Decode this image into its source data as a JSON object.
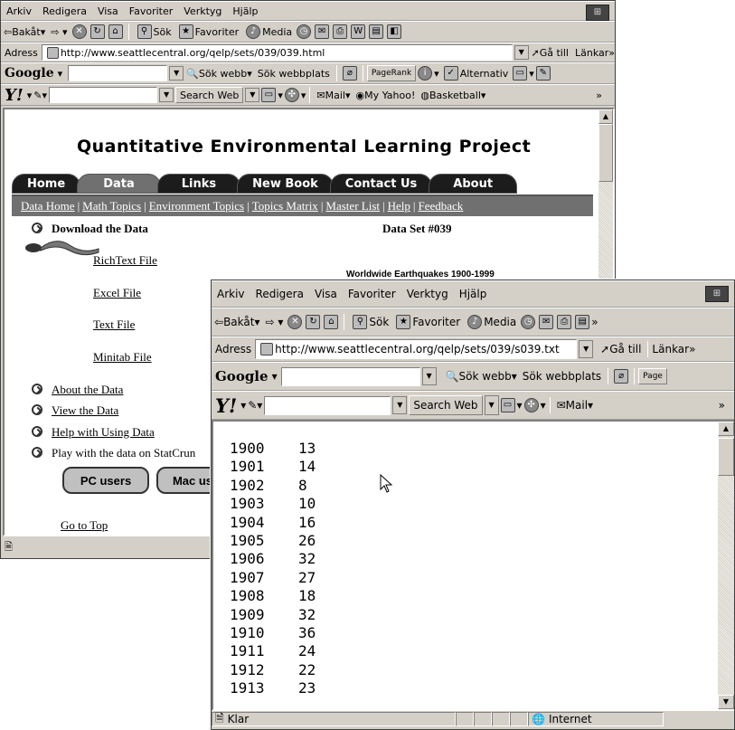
{
  "back": {
    "menu": [
      "Arkiv",
      "Redigera",
      "Visa",
      "Favoriter",
      "Verktyg",
      "Hjälp"
    ],
    "toolbar": {
      "back": "Bakåt",
      "search": "Sök",
      "favorites": "Favoriter",
      "media": "Media"
    },
    "address_label": "Adress",
    "address": "http://www.seattlecentral.org/qelp/sets/039/039.html",
    "go": "Gå till",
    "links": "Länkar",
    "google": {
      "logo": "Google",
      "search_web": "Sök webb",
      "search_site": "Sök webbplats",
      "pagerank": "PageRank",
      "options": "Alternativ"
    },
    "yahoo": {
      "logo": "Y!",
      "search_button": "Search Web",
      "mail": "Mail",
      "my_yahoo": "My Yahoo!",
      "basketball": "Basketball"
    },
    "page": {
      "title": "Quantitative Environmental Learning Project",
      "tabs": [
        "Home",
        "Data",
        "Links",
        "New Book",
        "Contact Us",
        "About"
      ],
      "subnav": [
        "Data Home",
        "Math Topics",
        "Environment Topics",
        "Topics Matrix",
        "Master List",
        "Help",
        "Feedback"
      ],
      "download_heading": "Download the Data",
      "dataset_id": "Data Set #039",
      "files": [
        "RichText File",
        "Excel File",
        "Text File",
        "Minitab File"
      ],
      "dataset_title": "Worldwide Earthquakes 1900-1999",
      "links": [
        "About the Data",
        "View the Data",
        "Help with Using Data"
      ],
      "statcrunch": "Play with the data on StatCrun",
      "pc_button": "PC users",
      "mac_button": "Mac us",
      "go_top": "Go to Top"
    }
  },
  "front": {
    "menu": [
      "Arkiv",
      "Redigera",
      "Visa",
      "Favoriter",
      "Verktyg",
      "Hjälp"
    ],
    "toolbar": {
      "back": "Bakåt",
      "search": "Sök",
      "favorites": "Favoriter",
      "media": "Media"
    },
    "address_label": "Adress",
    "address": "http://www.seattlecentral.org/qelp/sets/039/s039.txt",
    "go": "Gå till",
    "links": "Länkar",
    "google": {
      "logo": "Google",
      "search_web": "Sök webb",
      "search_site": "Sök webbplats",
      "pagerank": "Page"
    },
    "yahoo": {
      "logo": "Y!",
      "search_button": "Search Web",
      "mail": "Mail"
    },
    "status": {
      "done": "Klar",
      "zone": "Internet"
    },
    "rows": [
      [
        "1900",
        "13"
      ],
      [
        "1901",
        "14"
      ],
      [
        "1902",
        "8"
      ],
      [
        "1903",
        "10"
      ],
      [
        "1904",
        "16"
      ],
      [
        "1905",
        "26"
      ],
      [
        "1906",
        "32"
      ],
      [
        "1907",
        "27"
      ],
      [
        "1908",
        "18"
      ],
      [
        "1909",
        "32"
      ],
      [
        "1910",
        "36"
      ],
      [
        "1911",
        "24"
      ],
      [
        "1912",
        "22"
      ],
      [
        "1913",
        "23"
      ]
    ]
  }
}
